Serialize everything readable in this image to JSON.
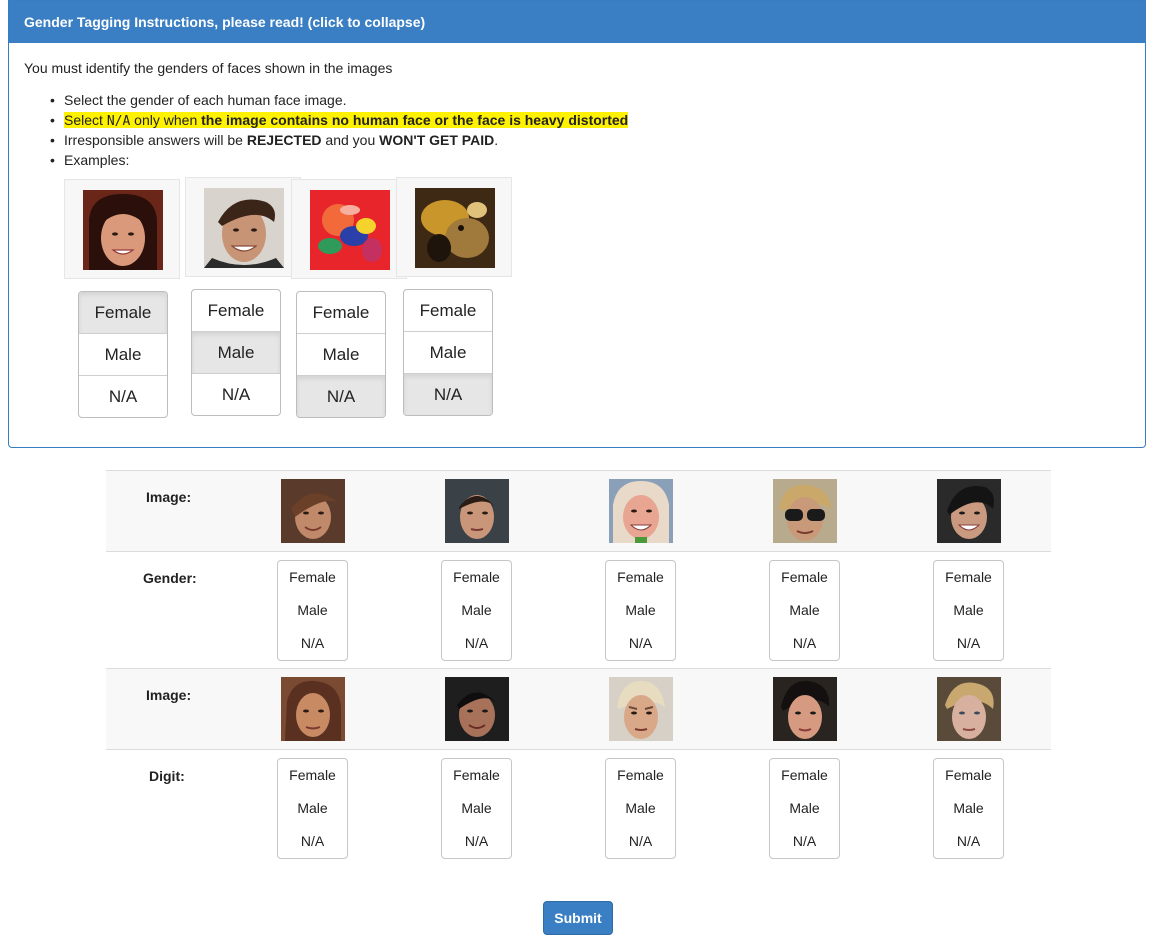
{
  "instructions": {
    "header": "Gender Tagging Instructions, please read! (click to collapse)",
    "intro": "You must identify the genders of faces shown in the images",
    "bullet1": "Select the gender of each human face image.",
    "bullet2_a": "Select ",
    "bullet2_code": "N/A",
    "bullet2_b": " only when ",
    "bullet2_c": "the image contains no human face or the face is heavy distorted",
    "bullet3_a": "Irresponsible answers will be ",
    "bullet3_b": "REJECTED",
    "bullet3_c": " and you ",
    "bullet3_d": "WON'T GET PAID",
    "bullet3_e": ".",
    "bullet4": "Examples:",
    "highlight_color": "#fff200"
  },
  "options": {
    "female": "Female",
    "male": "Male",
    "na": "N/A"
  },
  "examples": [
    {
      "selected": "Female"
    },
    {
      "selected": "Male"
    },
    {
      "selected": "N/A"
    },
    {
      "selected": "N/A"
    }
  ],
  "rows": [
    {
      "label": "Image:"
    },
    {
      "label": "Gender:"
    },
    {
      "label": "Image:"
    },
    {
      "label": "Digit:"
    }
  ],
  "submit_label": "Submit",
  "accent_color": "#3a7fc4"
}
